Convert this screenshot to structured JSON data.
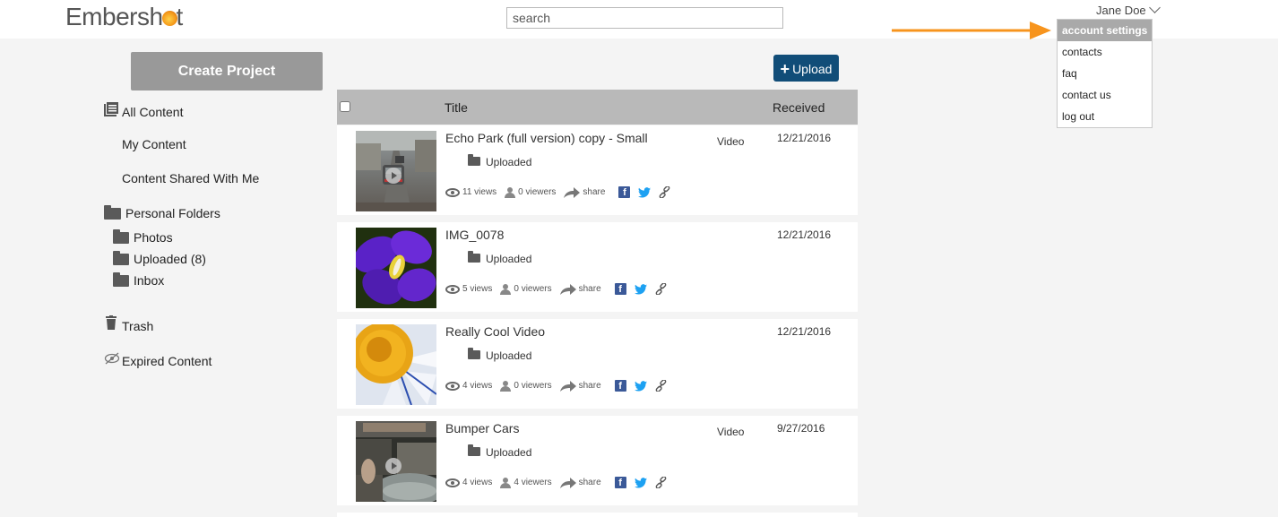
{
  "header": {
    "logo_pre": "Ember",
    "logo_post": "sh",
    "logo_end": "t",
    "search_placeholder": "search",
    "user_name": "Jane Doe"
  },
  "user_menu": {
    "items": [
      {
        "label": "account settings",
        "active": true
      },
      {
        "label": "contacts",
        "active": false
      },
      {
        "label": "faq",
        "active": false
      },
      {
        "label": "contact us",
        "active": false
      },
      {
        "label": "log out",
        "active": false
      }
    ]
  },
  "sidebar": {
    "create_label": "Create Project",
    "all_content": "All Content",
    "my_content": "My Content",
    "shared": "Content Shared With Me",
    "personal_folders": "Personal Folders",
    "folders": [
      "Photos",
      "Uploaded (8)",
      "Inbox"
    ],
    "trash": "Trash",
    "expired": "Expired Content"
  },
  "toolbar": {
    "upload_plus": "+",
    "upload_label": "Upload"
  },
  "table": {
    "col_title": "Title",
    "col_received": "Received"
  },
  "rows": [
    {
      "title": "Echo Park (full version) copy - Small",
      "folder": "Uploaded",
      "type": "Video",
      "date": "12/21/2016",
      "views": "11 views",
      "viewers": "0 viewers",
      "share": "share"
    },
    {
      "title": "IMG_0078",
      "folder": "Uploaded",
      "type": "",
      "date": "12/21/2016",
      "views": "5 views",
      "viewers": "0 viewers",
      "share": "share"
    },
    {
      "title": "Really Cool Video",
      "folder": "Uploaded",
      "type": "",
      "date": "12/21/2016",
      "views": "4 views",
      "viewers": "0 viewers",
      "share": "share"
    },
    {
      "title": "Bumper Cars",
      "folder": "Uploaded",
      "type": "Video",
      "date": "9/27/2016",
      "views": "4 views",
      "viewers": "4 viewers",
      "share": "share"
    }
  ],
  "social": {
    "facebook_letter": "f"
  },
  "colors": {
    "accent": "#114d78",
    "arrow": "#f7941d",
    "facebook": "#3b5998",
    "twitter": "#1da1f2"
  }
}
